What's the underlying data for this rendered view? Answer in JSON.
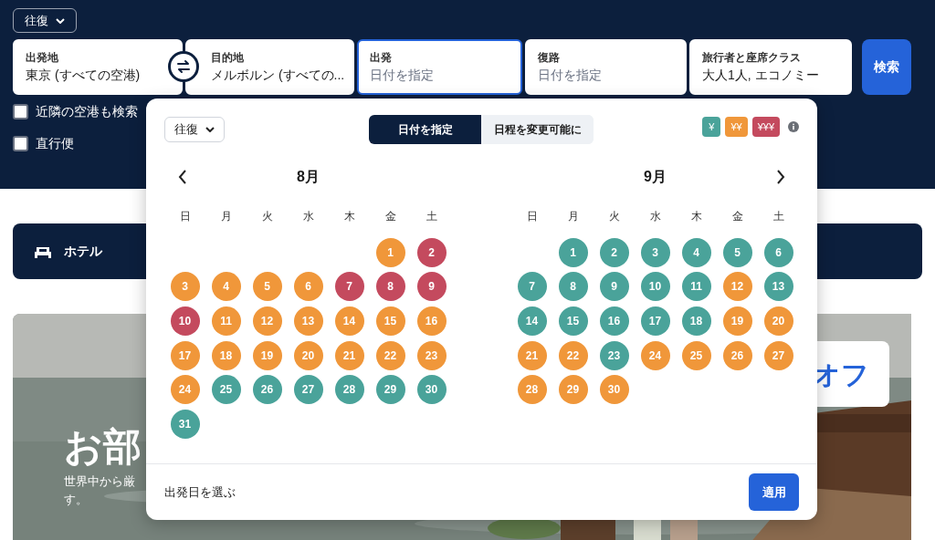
{
  "trip_type": "往復",
  "search_fields": [
    {
      "label": "出発地",
      "value": "東京 (すべての空港)",
      "focused": false
    },
    {
      "label": "目的地",
      "value": "メルボルン (すべての...",
      "focused": false
    },
    {
      "label": "出発",
      "placeholder": "日付を指定",
      "focused": true
    },
    {
      "label": "復路",
      "placeholder": "日付を指定",
      "focused": false
    },
    {
      "label": "旅行者と座席クラス",
      "value": "大人1人, エコノミー",
      "focused": false
    }
  ],
  "search_button": "検索",
  "options": [
    {
      "label": "近隣の空港も検索",
      "checked": false
    },
    {
      "label": "直行便",
      "checked": false
    }
  ],
  "hotel_tab": {
    "label": "ホテル"
  },
  "promo": {
    "headline": "お部",
    "subtitle_lines": [
      "世界中から厳",
      "す。"
    ],
    "badge": "オフ"
  },
  "date_picker": {
    "trip_type": "往復",
    "modes": [
      {
        "label": "日付を指定",
        "selected": true
      },
      {
        "label": "日程を変更可能に",
        "selected": false
      }
    ],
    "price_legend": [
      {
        "label": "¥",
        "color": "#4aa39a"
      },
      {
        "label": "¥¥",
        "color": "#f0973a"
      },
      {
        "label": "¥¥¥",
        "color": "#c44a5e"
      }
    ],
    "months": [
      {
        "title": "8月",
        "weekdays": [
          "日",
          "月",
          "火",
          "水",
          "木",
          "金",
          "土"
        ],
        "days": [
          {
            "kind": "blank"
          },
          {
            "kind": "blank"
          },
          {
            "kind": "blank"
          },
          {
            "kind": "blank"
          },
          {
            "kind": "blank"
          },
          {
            "kind": "day",
            "day": "1",
            "color": "#f0973a"
          },
          {
            "kind": "day",
            "day": "2",
            "color": "#c44a5e"
          },
          {
            "kind": "day",
            "day": "3",
            "color": "#f0973a"
          },
          {
            "kind": "day",
            "day": "4",
            "color": "#f0973a"
          },
          {
            "kind": "day",
            "day": "5",
            "color": "#f0973a"
          },
          {
            "kind": "day",
            "day": "6",
            "color": "#f0973a"
          },
          {
            "kind": "day",
            "day": "7",
            "color": "#c44a5e"
          },
          {
            "kind": "day",
            "day": "8",
            "color": "#c44a5e"
          },
          {
            "kind": "day",
            "day": "9",
            "color": "#c44a5e"
          },
          {
            "kind": "day",
            "day": "10",
            "color": "#c44a5e"
          },
          {
            "kind": "day",
            "day": "11",
            "color": "#f0973a"
          },
          {
            "kind": "day",
            "day": "12",
            "color": "#f0973a"
          },
          {
            "kind": "day",
            "day": "13",
            "color": "#f0973a"
          },
          {
            "kind": "day",
            "day": "14",
            "color": "#f0973a"
          },
          {
            "kind": "day",
            "day": "15",
            "color": "#f0973a"
          },
          {
            "kind": "day",
            "day": "16",
            "color": "#f0973a"
          },
          {
            "kind": "day",
            "day": "17",
            "color": "#f0973a"
          },
          {
            "kind": "day",
            "day": "18",
            "color": "#f0973a"
          },
          {
            "kind": "day",
            "day": "19",
            "color": "#f0973a"
          },
          {
            "kind": "day",
            "day": "20",
            "color": "#f0973a"
          },
          {
            "kind": "day",
            "day": "21",
            "color": "#f0973a"
          },
          {
            "kind": "day",
            "day": "22",
            "color": "#f0973a"
          },
          {
            "kind": "day",
            "day": "23",
            "color": "#f0973a"
          },
          {
            "kind": "day",
            "day": "24",
            "color": "#f0973a"
          },
          {
            "kind": "day",
            "day": "25",
            "color": "#4aa39a"
          },
          {
            "kind": "day",
            "day": "26",
            "color": "#4aa39a"
          },
          {
            "kind": "day",
            "day": "27",
            "color": "#4aa39a"
          },
          {
            "kind": "day",
            "day": "28",
            "color": "#4aa39a"
          },
          {
            "kind": "day",
            "day": "29",
            "color": "#4aa39a"
          },
          {
            "kind": "day",
            "day": "30",
            "color": "#4aa39a"
          },
          {
            "kind": "day",
            "day": "31",
            "color": "#4aa39a"
          }
        ]
      },
      {
        "title": "9月",
        "weekdays": [
          "日",
          "月",
          "火",
          "水",
          "木",
          "金",
          "土"
        ],
        "days": [
          {
            "kind": "blank"
          },
          {
            "kind": "day",
            "day": "1",
            "color": "#4aa39a"
          },
          {
            "kind": "day",
            "day": "2",
            "color": "#4aa39a"
          },
          {
            "kind": "day",
            "day": "3",
            "color": "#4aa39a"
          },
          {
            "kind": "day",
            "day": "4",
            "color": "#4aa39a"
          },
          {
            "kind": "day",
            "day": "5",
            "color": "#4aa39a"
          },
          {
            "kind": "day",
            "day": "6",
            "color": "#4aa39a"
          },
          {
            "kind": "day",
            "day": "7",
            "color": "#4aa39a"
          },
          {
            "kind": "day",
            "day": "8",
            "color": "#4aa39a"
          },
          {
            "kind": "day",
            "day": "9",
            "color": "#4aa39a"
          },
          {
            "kind": "day",
            "day": "10",
            "color": "#4aa39a"
          },
          {
            "kind": "day",
            "day": "11",
            "color": "#4aa39a"
          },
          {
            "kind": "day",
            "day": "12",
            "color": "#f0973a"
          },
          {
            "kind": "day",
            "day": "13",
            "color": "#4aa39a"
          },
          {
            "kind": "day",
            "day": "14",
            "color": "#4aa39a"
          },
          {
            "kind": "day",
            "day": "15",
            "color": "#4aa39a"
          },
          {
            "kind": "day",
            "day": "16",
            "color": "#4aa39a"
          },
          {
            "kind": "day",
            "day": "17",
            "color": "#4aa39a"
          },
          {
            "kind": "day",
            "day": "18",
            "color": "#4aa39a"
          },
          {
            "kind": "day",
            "day": "19",
            "color": "#f0973a"
          },
          {
            "kind": "day",
            "day": "20",
            "color": "#f0973a"
          },
          {
            "kind": "day",
            "day": "21",
            "color": "#f0973a"
          },
          {
            "kind": "day",
            "day": "22",
            "color": "#f0973a"
          },
          {
            "kind": "day",
            "day": "23",
            "color": "#4aa39a"
          },
          {
            "kind": "day",
            "day": "24",
            "color": "#f0973a"
          },
          {
            "kind": "day",
            "day": "25",
            "color": "#f0973a"
          },
          {
            "kind": "day",
            "day": "26",
            "color": "#f0973a"
          },
          {
            "kind": "day",
            "day": "27",
            "color": "#f0973a"
          },
          {
            "kind": "day",
            "day": "28",
            "color": "#f0973a"
          },
          {
            "kind": "day",
            "day": "29",
            "color": "#f0973a"
          },
          {
            "kind": "day",
            "day": "30",
            "color": "#f0973a"
          }
        ]
      }
    ],
    "footer": {
      "hint": "出発日を選ぶ",
      "apply": "適用"
    }
  }
}
